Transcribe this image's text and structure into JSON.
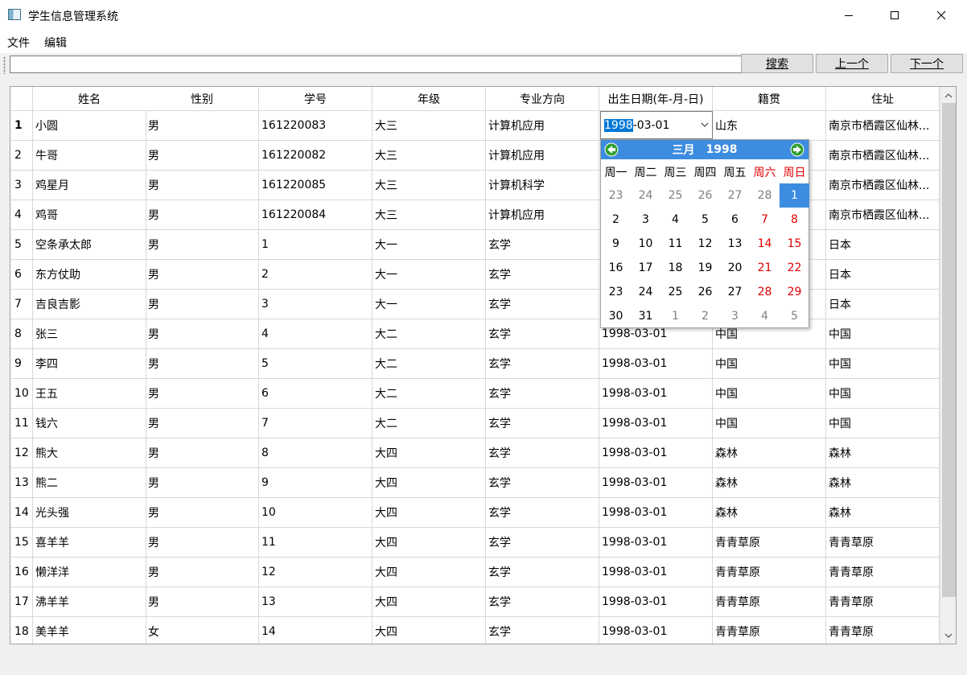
{
  "window": {
    "title": "学生信息管理系统"
  },
  "menu": {
    "items": [
      "文件",
      "编辑"
    ]
  },
  "toolbar": {
    "search_value": "",
    "buttons": [
      {
        "label": "搜索",
        "mnemonic": "索"
      },
      {
        "label": "上一个",
        "mnemonic": "上"
      },
      {
        "label": "下一个",
        "mnemonic": "下"
      }
    ]
  },
  "table": {
    "headers": [
      "姓名",
      "性别",
      "学号",
      "年级",
      "专业方向",
      "出生日期(年-月-日)",
      "籍贯",
      "住址"
    ],
    "current_row": 1,
    "rows": [
      {
        "n": "1",
        "cells": [
          "小圆",
          "男",
          "161220083",
          "大三",
          "计算机应用",
          "",
          "山东",
          "南京市栖霞区仙林..."
        ]
      },
      {
        "n": "2",
        "cells": [
          "牛哥",
          "男",
          "161220082",
          "大三",
          "计算机应用",
          "",
          "",
          "南京市栖霞区仙林..."
        ]
      },
      {
        "n": "3",
        "cells": [
          "鸡星月",
          "男",
          "161220085",
          "大三",
          "计算机科学",
          "",
          "",
          "南京市栖霞区仙林..."
        ]
      },
      {
        "n": "4",
        "cells": [
          "鸡哥",
          "男",
          "161220084",
          "大三",
          "计算机应用",
          "",
          "",
          "南京市栖霞区仙林..."
        ]
      },
      {
        "n": "5",
        "cells": [
          "空条承太郎",
          "男",
          "1",
          "大一",
          "玄学",
          "",
          "",
          "日本"
        ]
      },
      {
        "n": "6",
        "cells": [
          "东方仗助",
          "男",
          "2",
          "大一",
          "玄学",
          "",
          "",
          "日本"
        ]
      },
      {
        "n": "7",
        "cells": [
          "吉良吉影",
          "男",
          "3",
          "大一",
          "玄学",
          "",
          "",
          "日本"
        ]
      },
      {
        "n": "8",
        "cells": [
          "张三",
          "男",
          "4",
          "大二",
          "玄学",
          "1998-03-01",
          "中国",
          "中国"
        ]
      },
      {
        "n": "9",
        "cells": [
          "李四",
          "男",
          "5",
          "大二",
          "玄学",
          "1998-03-01",
          "中国",
          "中国"
        ]
      },
      {
        "n": "10",
        "cells": [
          "王五",
          "男",
          "6",
          "大二",
          "玄学",
          "1998-03-01",
          "中国",
          "中国"
        ]
      },
      {
        "n": "11",
        "cells": [
          "钱六",
          "男",
          "7",
          "大二",
          "玄学",
          "1998-03-01",
          "中国",
          "中国"
        ]
      },
      {
        "n": "12",
        "cells": [
          "熊大",
          "男",
          "8",
          "大四",
          "玄学",
          "1998-03-01",
          "森林",
          "森林"
        ]
      },
      {
        "n": "13",
        "cells": [
          "熊二",
          "男",
          "9",
          "大四",
          "玄学",
          "1998-03-01",
          "森林",
          "森林"
        ]
      },
      {
        "n": "14",
        "cells": [
          "光头强",
          "男",
          "10",
          "大四",
          "玄学",
          "1998-03-01",
          "森林",
          "森林"
        ]
      },
      {
        "n": "15",
        "cells": [
          "喜羊羊",
          "男",
          "11",
          "大四",
          "玄学",
          "1998-03-01",
          "青青草原",
          "青青草原"
        ]
      },
      {
        "n": "16",
        "cells": [
          "懒洋洋",
          "男",
          "12",
          "大四",
          "玄学",
          "1998-03-01",
          "青青草原",
          "青青草原"
        ]
      },
      {
        "n": "17",
        "cells": [
          "沸羊羊",
          "男",
          "13",
          "大四",
          "玄学",
          "1998-03-01",
          "青青草原",
          "青青草原"
        ]
      },
      {
        "n": "18",
        "cells": [
          "美羊羊",
          "女",
          "14",
          "大四",
          "玄学",
          "1998-03-01",
          "青青草原",
          "青青草原"
        ]
      }
    ]
  },
  "date_editor": {
    "year_selected": "1998",
    "rest": "-03-01"
  },
  "calendar": {
    "month": "三月",
    "year": "1998",
    "weekdays": [
      "周一",
      "周二",
      "周三",
      "周四",
      "周五",
      "周六",
      "周日"
    ],
    "weeks": [
      [
        "23",
        "24",
        "25",
        "26",
        "27",
        "28",
        "1"
      ],
      [
        "2",
        "3",
        "4",
        "5",
        "6",
        "7",
        "8"
      ],
      [
        "9",
        "10",
        "11",
        "12",
        "13",
        "14",
        "15"
      ],
      [
        "16",
        "17",
        "18",
        "19",
        "20",
        "21",
        "22"
      ],
      [
        "23",
        "24",
        "25",
        "26",
        "27",
        "28",
        "29"
      ],
      [
        "30",
        "31",
        "1",
        "2",
        "3",
        "4",
        "5"
      ]
    ],
    "selected_day": "1",
    "colors": {
      "header": "#3c8ce0",
      "weekend": "#e00000",
      "other_month": "#808080",
      "selected": "#3c8ce0"
    }
  }
}
